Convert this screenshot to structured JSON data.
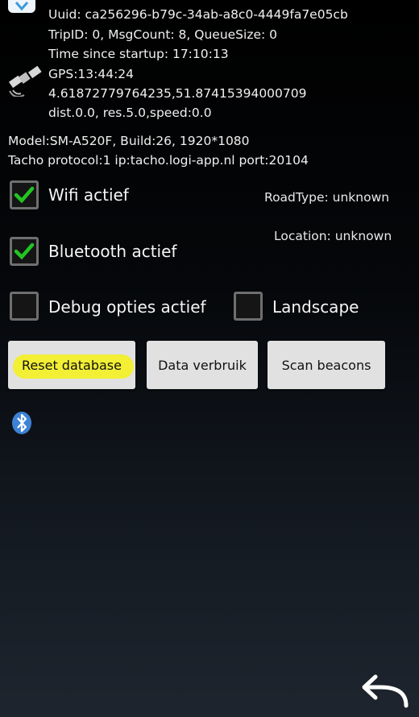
{
  "info": {
    "uuid": "Uuid: ca256296-b79c-34ab-a8c0-4449fa7e05cb",
    "trip": "TripID: 0, MsgCount: 8, QueueSize: 0",
    "startup": "Time since startup: 17:10:13",
    "gps_time": "GPS:13:44:24",
    "gps_coords": "4.61872779764235,51.87415394000709",
    "gps_stats": "dist.0.0, res.5.0,speed:0.0",
    "model": "Model:SM-A520F, Build:26, 1920*1080",
    "tacho": "Tacho protocol:1 ip:tacho.logi-app.nl port:20104"
  },
  "options": {
    "wifi_label": "Wifi actief",
    "bluetooth_label": "Bluetooth actief",
    "debug_label": "Debug opties actief",
    "landscape_label": "Landscape",
    "wifi_checked": true,
    "bluetooth_checked": true,
    "debug_checked": false,
    "landscape_checked": false
  },
  "status": {
    "road_type": "RoadType: unknown",
    "location": "Location: unknown"
  },
  "buttons": {
    "reset_database": "Reset database",
    "data_usage": "Data verbruik",
    "scan_beacons": "Scan beacons"
  },
  "icons": {
    "app": "app-logo-icon",
    "gps": "satellite-icon",
    "bluetooth": "bluetooth-icon",
    "back": "back-arrow-icon"
  },
  "colors": {
    "check_green": "#22c522",
    "highlight_yellow": "#f2ef2a",
    "button_bg": "#e1e1e1",
    "bluetooth_blue": "#3d82d6"
  }
}
